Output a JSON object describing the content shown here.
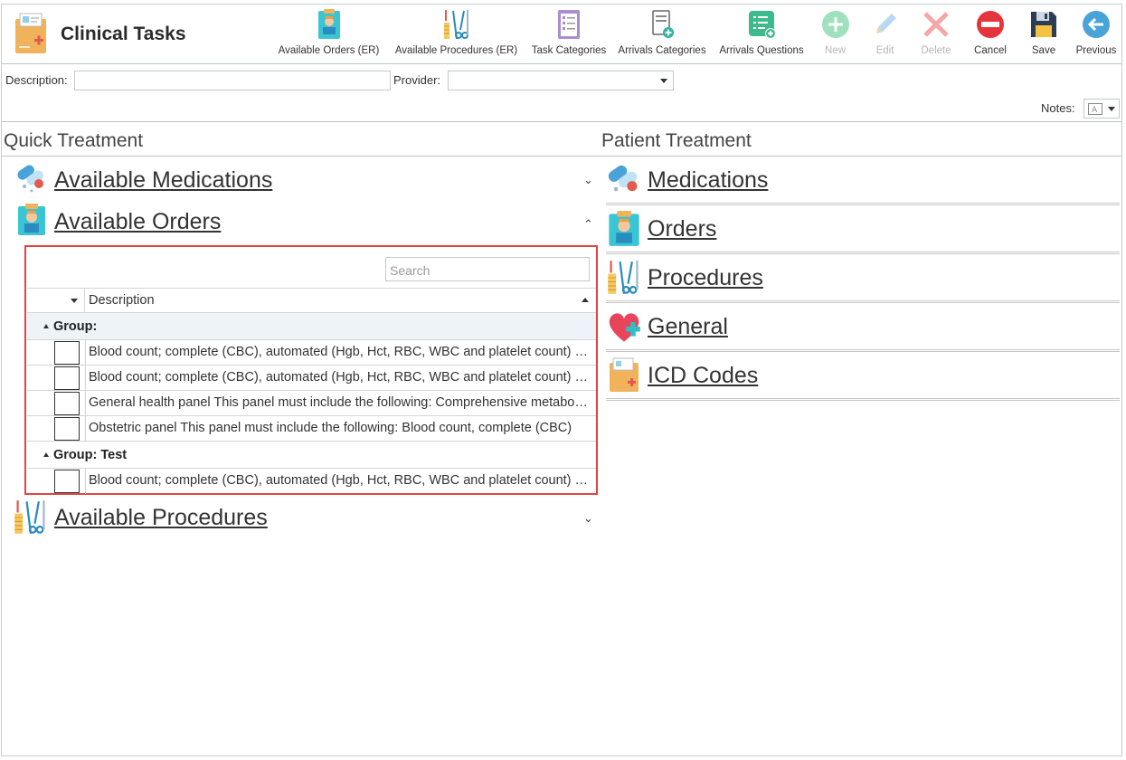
{
  "app": {
    "title": "Clinical Tasks"
  },
  "toolbar": [
    {
      "name": "available-orders-er-button",
      "label": "Available Orders (ER)",
      "icon": "clipboard-doctor-icon",
      "disabled": false
    },
    {
      "name": "available-procedures-er-button",
      "label": "Available Procedures (ER)",
      "icon": "surgical-instruments-icon",
      "disabled": false
    },
    {
      "name": "task-categories-button",
      "label": "Task Categories",
      "icon": "checklist-icon",
      "disabled": false
    },
    {
      "name": "arrivals-categories-button",
      "label": "Arrivals Categories",
      "icon": "document-add-icon",
      "disabled": false
    },
    {
      "name": "arrivals-questions-button",
      "label": "Arrivals Questions",
      "icon": "list-add-icon",
      "disabled": false
    },
    {
      "name": "new-button",
      "label": "New",
      "icon": "plus-circle-icon",
      "disabled": true
    },
    {
      "name": "edit-button",
      "label": "Edit",
      "icon": "pencil-icon",
      "disabled": true
    },
    {
      "name": "delete-button",
      "label": "Delete",
      "icon": "x-icon",
      "disabled": true
    },
    {
      "name": "cancel-button",
      "label": "Cancel",
      "icon": "no-entry-icon",
      "disabled": false
    },
    {
      "name": "save-button",
      "label": "Save",
      "icon": "floppy-disk-icon",
      "disabled": false
    },
    {
      "name": "previous-button",
      "label": "Previous",
      "icon": "arrow-left-circle-icon",
      "disabled": false
    }
  ],
  "filters": {
    "description_label": "Description:",
    "description_value": "",
    "provider_label": "Provider:",
    "provider_value": "",
    "notes_label": "Notes:"
  },
  "quick_treatment": {
    "title": "Quick Treatment",
    "sections": [
      {
        "label": "Available Medications",
        "icon": "pills-icon",
        "expanded": false
      },
      {
        "label": "Available Orders",
        "icon": "clipboard-doctor-icon",
        "expanded": true
      },
      {
        "label": "Available Procedures",
        "icon": "surgical-instruments-icon",
        "expanded": false
      }
    ],
    "orders_grid": {
      "search_placeholder": "Search",
      "column_header": "Description",
      "groups": [
        {
          "label": "Group:",
          "rows": [
            "Blood count; complete (CBC), automated (Hgb, Hct, RBC, WBC and platelet count) and automated differential WBC count",
            "Blood count; complete (CBC), automated (Hgb, Hct, RBC, WBC and platelet count) and manual differential WBC count",
            "General health panel This panel must include the following: Comprehensive metabolic panel",
            "Obstetric panel This panel must include the following: Blood count, complete (CBC)"
          ]
        },
        {
          "label": "Group: Test",
          "rows": [
            "Blood count; complete (CBC), automated (Hgb, Hct, RBC, WBC and platelet count) and automated differential WBC count"
          ]
        }
      ]
    }
  },
  "patient_treatment": {
    "title": "Patient Treatment",
    "items": [
      {
        "label": "Medications",
        "icon": "pills-icon"
      },
      {
        "label": "Orders",
        "icon": "clipboard-doctor-icon"
      },
      {
        "label": "Procedures",
        "icon": "surgical-instruments-icon"
      },
      {
        "label": "General",
        "icon": "heart-plus-icon"
      },
      {
        "label": "ICD Codes",
        "icon": "medical-folder-icon"
      }
    ]
  },
  "colors": {
    "highlight_border": "#e04545",
    "group_row_bg": "#eef3f8",
    "divider": "#b9c3cc"
  }
}
